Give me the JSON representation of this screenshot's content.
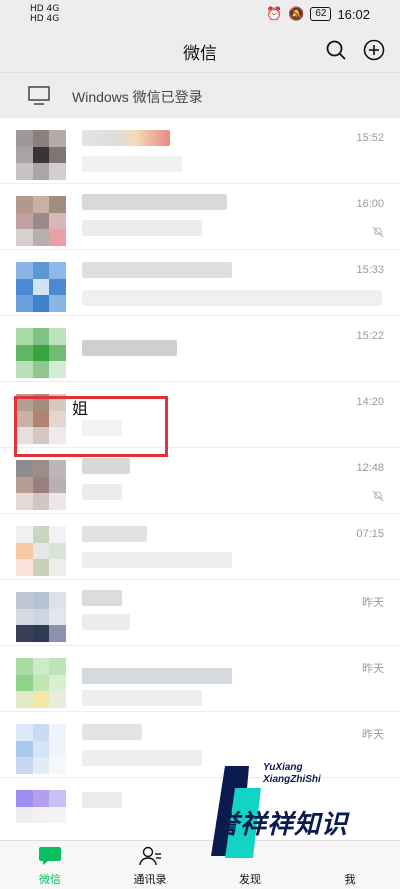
{
  "status_bar": {
    "left_top": "HD 4G",
    "left_bottom": "HD 4G",
    "battery": "62",
    "time": "16:02"
  },
  "header": {
    "title": "微信"
  },
  "banner": {
    "text": "Windows 微信已登录"
  },
  "chats": [
    {
      "time": "15:52",
      "name": "",
      "muted": false
    },
    {
      "time": "16:00",
      "name": "",
      "muted": true
    },
    {
      "time": "15:33",
      "name": "",
      "muted": false
    },
    {
      "time": "15:22",
      "name": "",
      "muted": false
    },
    {
      "time": "14:20",
      "name": "姐",
      "muted": false
    },
    {
      "time": "12:48",
      "name": "",
      "muted": true
    },
    {
      "time": "07:15",
      "name": "",
      "muted": false
    },
    {
      "time": "昨天",
      "name": "",
      "muted": false
    },
    {
      "time": "昨天",
      "name": "",
      "muted": false
    },
    {
      "time": "昨天",
      "name": "",
      "muted": false
    }
  ],
  "tabs": [
    {
      "label": "微信",
      "active": true
    },
    {
      "label": "通讯录",
      "active": false
    },
    {
      "label": "发现",
      "active": false
    },
    {
      "label": "我",
      "active": false
    }
  ],
  "watermark": {
    "line1": "YuXiang",
    "line2": "XiangZhiShi",
    "big": "誉祥祥知识"
  },
  "colors": {
    "accent": "#07c160",
    "highlight_box": "#e53238",
    "background": "#ededed"
  }
}
